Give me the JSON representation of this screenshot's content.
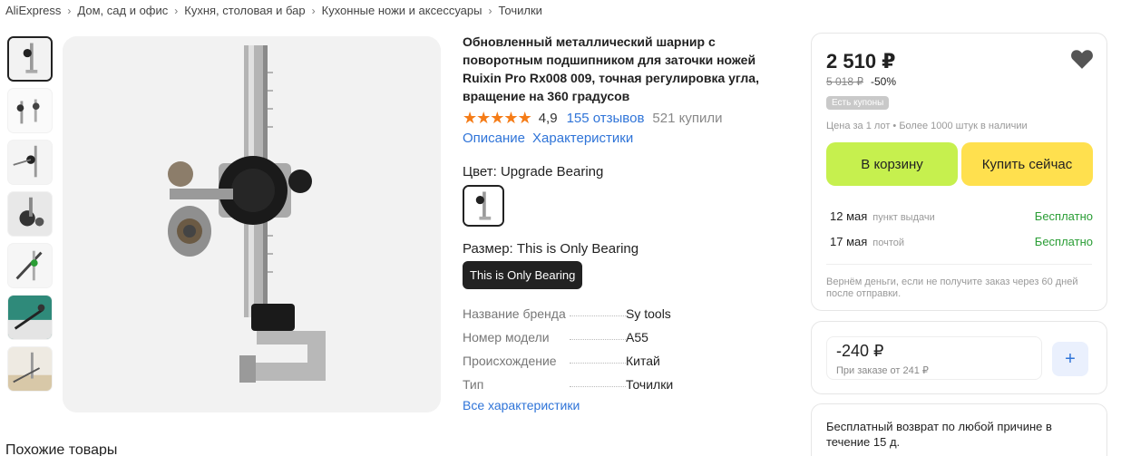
{
  "breadcrumb": [
    "AliExpress",
    "Дом, сад и офис",
    "Кухня, столовая и бар",
    "Кухонные ножи и аксессуары",
    "Точилки"
  ],
  "product": {
    "title": "Обновленный металлический шарнир с поворотным подшипником для заточки ножей Ruixin Pro Rx008 009, точная регулировка угла, вращение на 360 градусов",
    "rating": "4,9",
    "stars": 5,
    "reviews": "155 отзывов",
    "bought": "521 купили",
    "links": [
      "Описание",
      "Характеристики"
    ],
    "color_label": "Цвет: Upgrade Bearing",
    "size_label": "Размер: This is Only Bearing",
    "size_option": "This is Only Bearing",
    "specs": [
      {
        "name": "Название бренда",
        "value": "Sy tools"
      },
      {
        "name": "Номер модели",
        "value": "A55"
      },
      {
        "name": "Происхождение",
        "value": "Китай"
      },
      {
        "name": "Тип",
        "value": "Точилки"
      }
    ],
    "all_specs_link": "Все характеристики"
  },
  "buy_box": {
    "price": "2 510 ₽",
    "old_price": "5 018 ₽",
    "discount": "-50%",
    "coupon_badge": "Есть купоны",
    "stock": "Цена за 1 лот • Более 1000 штук в наличии",
    "cart_button": "В корзину",
    "buy_button": "Купить сейчас",
    "delivery": [
      {
        "date": "12 мая",
        "method": "пункт выдачи",
        "price": "Бесплатно"
      },
      {
        "date": "17 мая",
        "method": "почтой",
        "price": "Бесплатно"
      }
    ],
    "refund_note": "Вернём деньги, если не получите заказ через 60 дней после отправки.",
    "accent_green": "#c6f04e",
    "accent_yellow": "#ffe04e"
  },
  "coupon": {
    "amount": "-240 ₽",
    "condition": "При заказе от 241 ₽",
    "add_icon": "plus-icon"
  },
  "returns": {
    "text": "Бесплатный возврат по любой причине в течение 15 д."
  },
  "similar": {
    "title": "Похожие товары"
  },
  "icons": {
    "favorite": "heart-icon",
    "separator": "chevron-right-icon",
    "star": "star-icon"
  }
}
